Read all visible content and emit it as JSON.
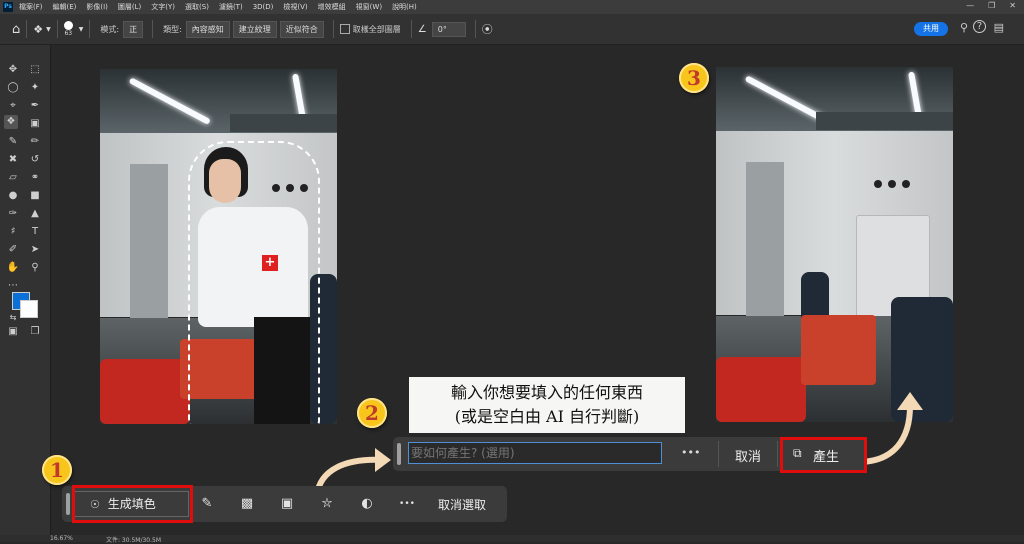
{
  "menu": {
    "app_icon": "Ps",
    "items": [
      "檔案(F)",
      "編輯(E)",
      "影像(I)",
      "圖層(L)",
      "文字(Y)",
      "選取(S)",
      "濾鏡(T)",
      "3D(D)",
      "檢視(V)",
      "增效模組",
      "視窗(W)",
      "說明(H)"
    ]
  },
  "options_bar": {
    "brush_size": "63",
    "mode_label": "模式:",
    "mode_value": "正",
    "type_label": "類型:",
    "type_buttons": [
      "內容感知",
      "建立紋理",
      "近似符合"
    ],
    "sample_all_layers": "取樣全部圖層",
    "angle_value": "0°",
    "share_label": "共用"
  },
  "toolbar": {
    "tools": [
      "move-tool",
      "marquee-tool",
      "lasso-tool",
      "magic-wand-tool",
      "crop-tool",
      "eyedropper-tool",
      "spot-healing-tool",
      "brush-tool",
      "clone-stamp-tool",
      "history-brush-tool",
      "eraser-tool",
      "gradient-tool",
      "dodge-tool",
      "pen-tool",
      "type-tool",
      "path-selection-tool",
      "shape-tool",
      "hand-tool",
      "zoom-tool",
      "more-tools"
    ],
    "foreground_color": "#0a6fd6",
    "background_color": "#ffffff"
  },
  "annotations": {
    "step1": "1",
    "step2": "2",
    "step3": "3",
    "callout_line1": "輸入你想要填入的任何東西",
    "callout_line2": "(或是空白由 AI 自行判斷)"
  },
  "contextual_bar": {
    "generative_fill": "生成填色",
    "deselect": "取消選取",
    "more": "•••"
  },
  "prompt_bar": {
    "placeholder": "要如何產生? (選用)",
    "more": "•••",
    "cancel": "取消",
    "generate": "產生"
  },
  "status_bar": {
    "zoom": "16.67%",
    "doc_size": "文件: 30.5M/30.5M"
  },
  "colors": {
    "accent_blue": "#1473e6",
    "annotation_red": "#e00d0d",
    "annotation_yellow": "#f7c51b"
  }
}
